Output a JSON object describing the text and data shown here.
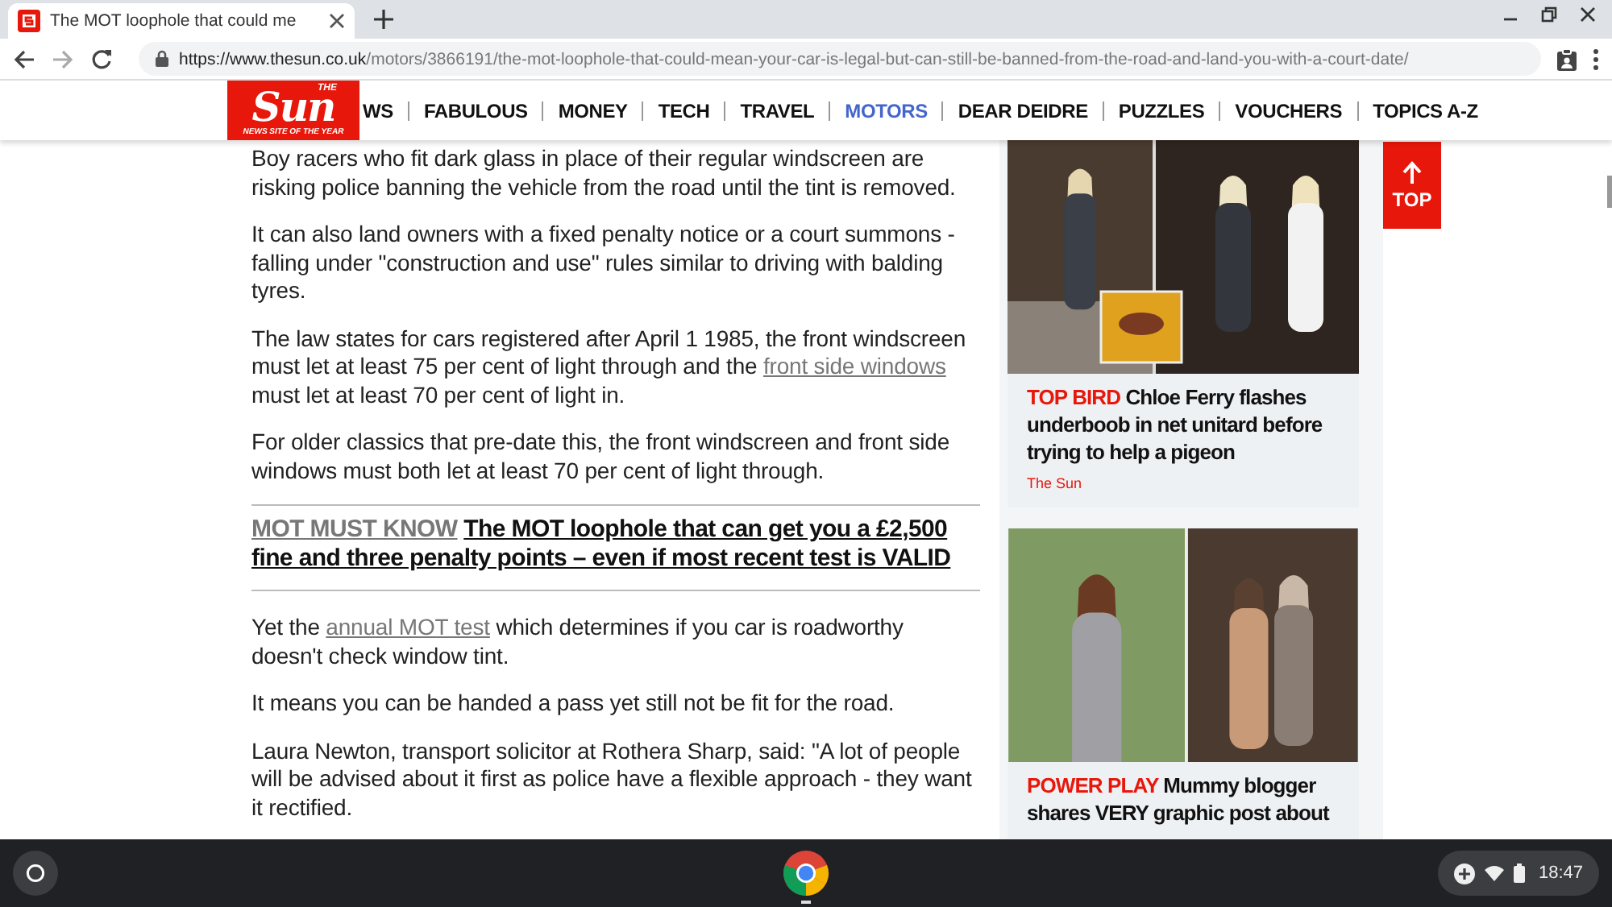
{
  "browser": {
    "tab": {
      "title": "The MOT loophole that could me",
      "selected": true
    },
    "url": {
      "domain": "https://www.thesun.co.uk",
      "path": "/motors/3866191/the-mot-loophole-that-could-mean-your-car-is-legal-but-can-still-be-banned-from-the-road-and-land-you-with-a-court-date/"
    }
  },
  "site_nav": {
    "logo": {
      "top": "THE",
      "name": "Sun",
      "tagline": "NEWS SITE OF THE YEAR"
    },
    "items": [
      {
        "label": "WS",
        "selected": false
      },
      {
        "label": "FABULOUS",
        "selected": false
      },
      {
        "label": "MONEY",
        "selected": false
      },
      {
        "label": "TECH",
        "selected": false
      },
      {
        "label": "TRAVEL",
        "selected": false
      },
      {
        "label": "MOTORS",
        "selected": true
      },
      {
        "label": "DEAR DEIDRE",
        "selected": false
      },
      {
        "label": "PUZZLES",
        "selected": false
      },
      {
        "label": "VOUCHERS",
        "selected": false
      },
      {
        "label": "TOPICS A-Z",
        "selected": false
      }
    ]
  },
  "article": {
    "blocks": [
      {
        "kind": "paragraph",
        "parts": [
          {
            "text": "Boy racers who fit dark glass in place of their regular windscreen are risking police banning the vehicle from the road until the tint is removed."
          }
        ]
      },
      {
        "kind": "paragraph",
        "parts": [
          {
            "text": "It can also land owners with a fixed penalty notice or a court summons - falling under \"construction and use\" rules similar to driving with balding tyres."
          }
        ]
      },
      {
        "kind": "paragraph",
        "parts": [
          {
            "text": "The law states for cars registered after April 1 1985, the front windscreen must let at least 75 per cent of light through and the "
          },
          {
            "text": "front side windows",
            "link": true
          },
          {
            "text": " must let at least 70 per cent of light in."
          }
        ]
      },
      {
        "kind": "paragraph",
        "parts": [
          {
            "text": "For older classics that pre-date this, the front windscreen and front side windows must both let at least 70 per cent of light through."
          }
        ]
      },
      {
        "kind": "related",
        "kicker": "MOT MUST KNOW",
        "headline": "The MOT loophole that can get you a £2,500 fine and three penalty points – even if most recent test is VALID"
      },
      {
        "kind": "paragraph",
        "parts": [
          {
            "text": "Yet the "
          },
          {
            "text": "annual MOT test",
            "link": true
          },
          {
            "text": " which determines if you car is roadworthy doesn't check window tint."
          }
        ]
      },
      {
        "kind": "paragraph",
        "parts": [
          {
            "text": "It means you can be handed a pass yet still not be fit for the road."
          }
        ]
      },
      {
        "kind": "paragraph",
        "parts": [
          {
            "text": "Laura Newton, transport solicitor at Rothera Sharp, said: \"A lot of people will be advised about it first as police have a flexible approach - they want it rectified."
          }
        ]
      }
    ]
  },
  "sidebar": {
    "cards": [
      {
        "kicker": "TOP BIRD",
        "headline": "Chloe Ferry flashes underboob in net unitard before trying to help a pigeon",
        "source": "The Sun"
      },
      {
        "kicker": "POWER PLAY",
        "headline": "Mummy blogger shares VERY graphic post about"
      }
    ]
  },
  "top_button": {
    "label": "TOP"
  },
  "shelf": {
    "time": "18:47"
  }
}
